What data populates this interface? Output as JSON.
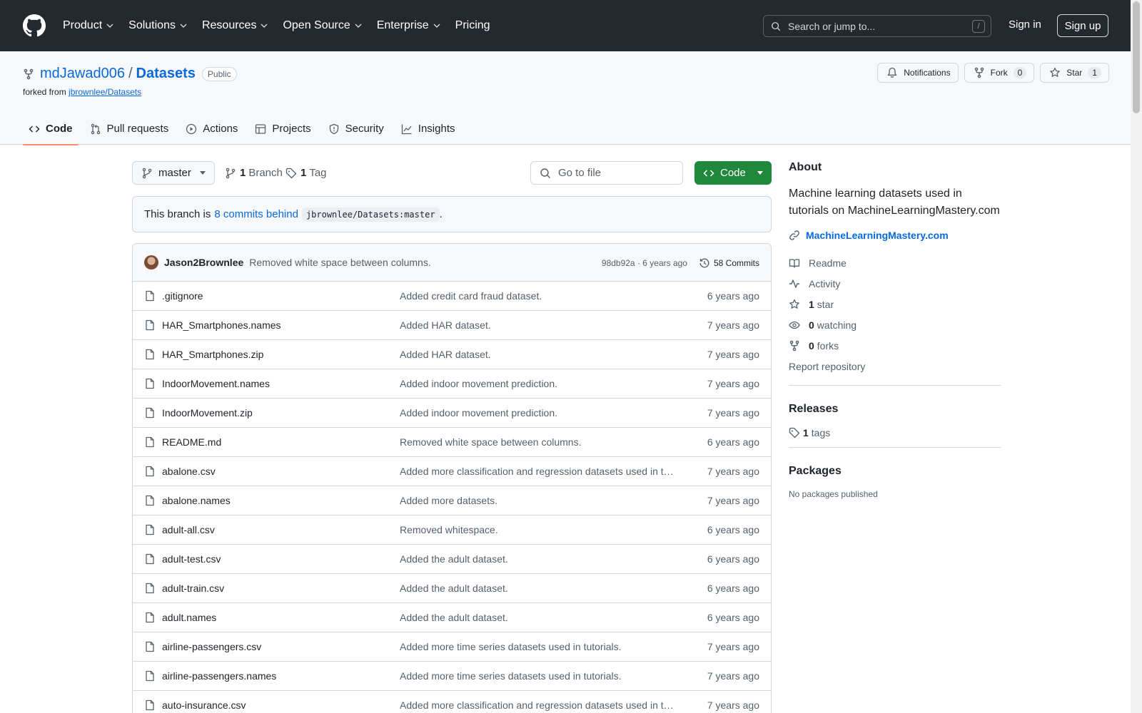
{
  "header": {
    "nav": [
      "Product",
      "Solutions",
      "Resources",
      "Open Source",
      "Enterprise",
      "Pricing"
    ],
    "search_placeholder": "Search or jump to...",
    "search_shortcut": "/",
    "sign_in": "Sign in",
    "sign_up": "Sign up"
  },
  "repo": {
    "owner": "mdJawad006",
    "separator": "/",
    "name": "Datasets",
    "visibility": "Public",
    "forked_prefix": "forked from",
    "forked_from": "jbrownlee/Datasets",
    "notifications_label": "Notifications",
    "fork_label": "Fork",
    "fork_count": "0",
    "star_label": "Star",
    "star_count": "1"
  },
  "tabs": [
    "Code",
    "Pull requests",
    "Actions",
    "Projects",
    "Security",
    "Insights"
  ],
  "active_tab": "Code",
  "toolbar": {
    "branch": "master",
    "branch_count": "1",
    "branch_label": "Branch",
    "tag_count": "1",
    "tag_label": "Tag",
    "goto_placeholder": "Go to file",
    "code_label": "Code"
  },
  "behind": {
    "prefix": "This branch is",
    "link": "8 commits behind",
    "ref": "jbrownlee/Datasets:master",
    "suffix": "."
  },
  "latest_commit": {
    "author": "Jason2Brownlee",
    "message": "Removed white space between columns.",
    "hash_time": "98db92a · 6 years ago",
    "commits": "58 Commits"
  },
  "files": [
    {
      "name": ".gitignore",
      "msg": "Added credit card fraud dataset.",
      "age": "6 years ago"
    },
    {
      "name": "HAR_Smartphones.names",
      "msg": "Added HAR dataset.",
      "age": "7 years ago"
    },
    {
      "name": "HAR_Smartphones.zip",
      "msg": "Added HAR dataset.",
      "age": "7 years ago"
    },
    {
      "name": "IndoorMovement.names",
      "msg": "Added indoor movement prediction.",
      "age": "7 years ago"
    },
    {
      "name": "IndoorMovement.zip",
      "msg": "Added indoor movement prediction.",
      "age": "7 years ago"
    },
    {
      "name": "README.md",
      "msg": "Removed white space between columns.",
      "age": "6 years ago"
    },
    {
      "name": "abalone.csv",
      "msg": "Added more classification and regression datasets used in t…",
      "age": "7 years ago"
    },
    {
      "name": "abalone.names",
      "msg": "Added more datasets.",
      "age": "7 years ago"
    },
    {
      "name": "adult-all.csv",
      "msg": "Removed whitespace.",
      "age": "6 years ago"
    },
    {
      "name": "adult-test.csv",
      "msg": "Added the adult dataset.",
      "age": "6 years ago"
    },
    {
      "name": "adult-train.csv",
      "msg": "Added the adult dataset.",
      "age": "6 years ago"
    },
    {
      "name": "adult.names",
      "msg": "Added the adult dataset.",
      "age": "6 years ago"
    },
    {
      "name": "airline-passengers.csv",
      "msg": "Added more time series datasets used in tutorials.",
      "age": "7 years ago"
    },
    {
      "name": "airline-passengers.names",
      "msg": "Added more time series datasets used in tutorials.",
      "age": "7 years ago"
    },
    {
      "name": "auto-insurance.csv",
      "msg": "Added more classification and regression datasets used in t…",
      "age": "7 years ago"
    }
  ],
  "about": {
    "title": "About",
    "description": "Machine learning datasets used in tutorials on MachineLearningMastery.com",
    "link": "MachineLearningMastery.com",
    "readme": "Readme",
    "activity": "Activity",
    "stars_count": "1",
    "stars_label": "star",
    "watching_count": "0",
    "watching_label": "watching",
    "forks_count": "0",
    "forks_label": "forks",
    "report": "Report repository"
  },
  "releases": {
    "title": "Releases",
    "tags_count": "1",
    "tags_label": "tags"
  },
  "packages": {
    "title": "Packages",
    "empty": "No packages published"
  },
  "colors": {
    "header_bg": "#24292f",
    "link": "#0969da",
    "code_button": "#1f883d",
    "active_tab_underline": "#fd8c73"
  }
}
